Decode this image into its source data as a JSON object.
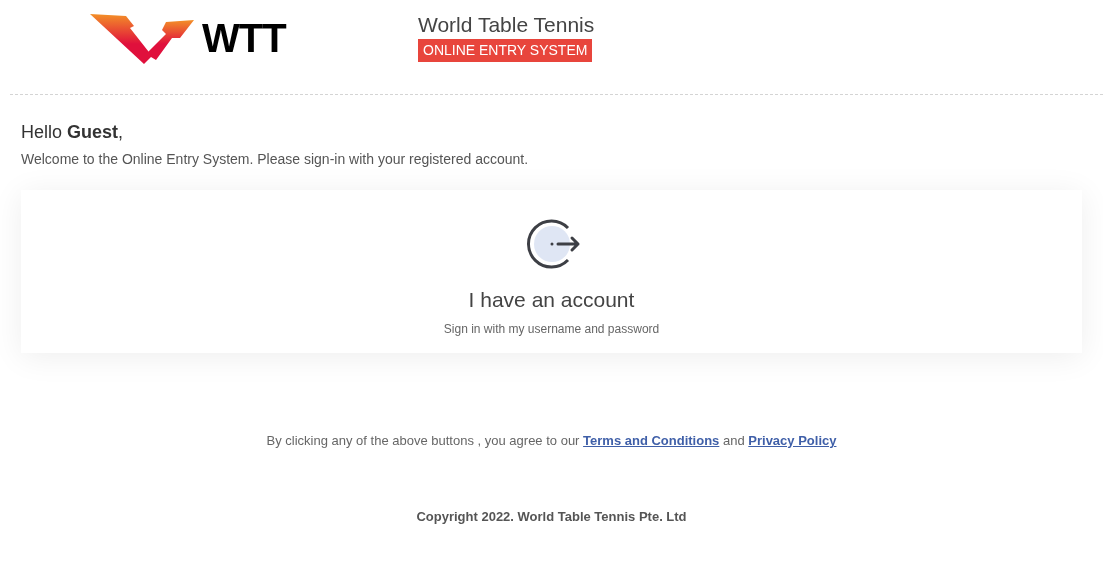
{
  "header": {
    "logo_text": "WTT",
    "title": "World Table Tennis",
    "badge": "ONLINE ENTRY SYSTEM"
  },
  "greeting": "Hello **Guest**,",
  "welcome": "Welcome to the Online Entry System. Please sign-in with your registered account.",
  "account_card": {
    "title": "I have an account",
    "subtitle": "Sign in with my username and password"
  },
  "consent": {
    "text": "By clicking any of the above buttons , you agree to our",
    "links": [
      "Terms and Conditions",
      "Privacy Policy"
    ],
    "joiner": "and"
  },
  "copyright": "Copyright 2022. World Table Tennis Pte. Ltd"
}
